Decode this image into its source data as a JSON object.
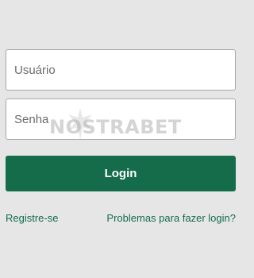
{
  "form": {
    "username_placeholder": "Usuário",
    "password_placeholder": "Senha",
    "login_label": "Login"
  },
  "links": {
    "register": "Registre-se",
    "problems": "Problemas para fazer login?"
  },
  "watermark": {
    "text": "NOSTRABET"
  },
  "colors": {
    "background": "#e6e6e6",
    "primary": "#146c4b",
    "link": "#146c4b",
    "input_border": "#a8a8a8"
  }
}
